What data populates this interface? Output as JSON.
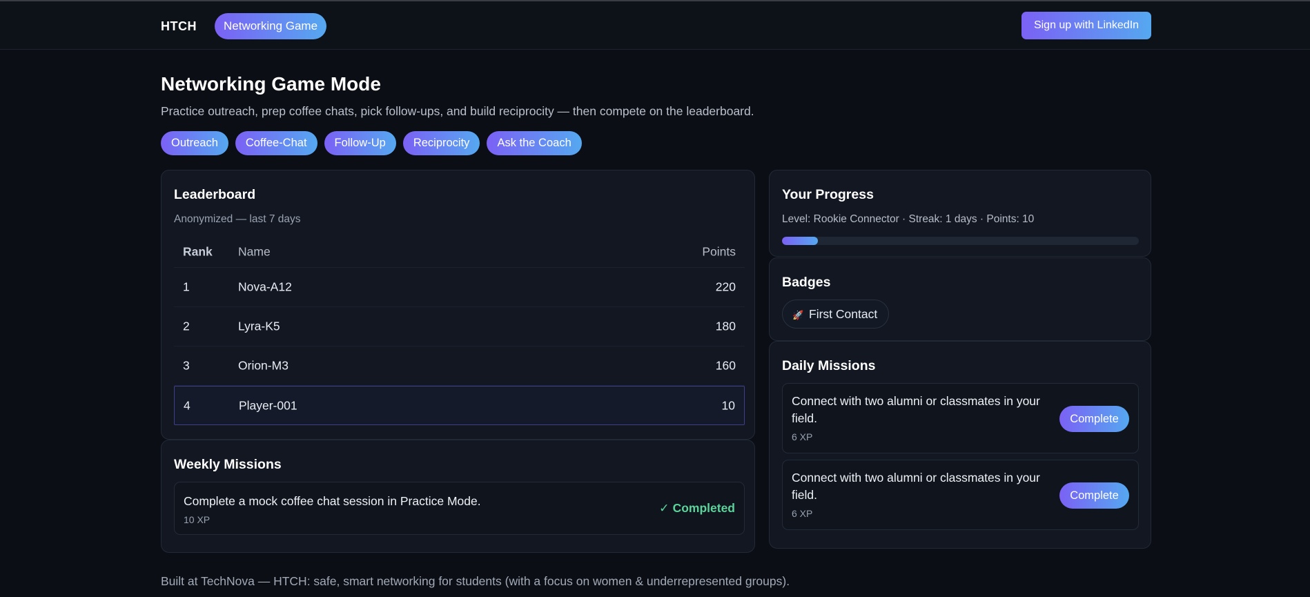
{
  "header": {
    "brand": "HTCH",
    "nav_pill": "Networking Game",
    "signup": "Sign up with LinkedIn"
  },
  "page": {
    "title": "Networking Game Mode",
    "subtitle": "Practice outreach, prep coffee chats, pick follow-ups, and build reciprocity — then compete on the leaderboard.",
    "chips": [
      "Outreach",
      "Coffee-Chat",
      "Follow-Up",
      "Reciprocity",
      "Ask the Coach"
    ]
  },
  "leaderboard": {
    "title": "Leaderboard",
    "subtitle": "Anonymized — last 7 days",
    "columns": [
      "Rank",
      "Name",
      "Points"
    ],
    "rows": [
      {
        "rank": "1",
        "name": "Nova-A12",
        "points": "220"
      },
      {
        "rank": "2",
        "name": "Lyra-K5",
        "points": "180"
      },
      {
        "rank": "3",
        "name": "Orion-M3",
        "points": "160"
      },
      {
        "rank": "4",
        "name": "Player-001",
        "points": "10"
      }
    ]
  },
  "weekly": {
    "title": "Weekly Missions",
    "mission": {
      "text": "Complete a mock coffee chat session in Practice Mode.",
      "xp": "10 XP",
      "status": "✓ Completed"
    }
  },
  "progress": {
    "title": "Your Progress",
    "stats": "Level: Rookie Connector · Streak: 1 days · Points: 10",
    "fill_percent": 10
  },
  "badges": {
    "title": "Badges",
    "items": [
      {
        "label": "First Contact",
        "icon": "rocket-icon"
      }
    ]
  },
  "daily": {
    "title": "Daily Missions",
    "missions": [
      {
        "text": "Connect with two alumni or classmates in your field.",
        "xp": "6 XP",
        "button": "Complete"
      },
      {
        "text": "Connect with two alumni or classmates in your field.",
        "xp": "6 XP",
        "button": "Complete"
      }
    ]
  },
  "footer": {
    "text": "Built at TechNova — HTCH: safe, smart networking for students (with a focus on women & underrepresented groups)."
  },
  "colors": {
    "accent_start": "#7b61f5",
    "accent_end": "#55a8f0",
    "success": "#5cd39b",
    "background": "#0b0e14"
  }
}
